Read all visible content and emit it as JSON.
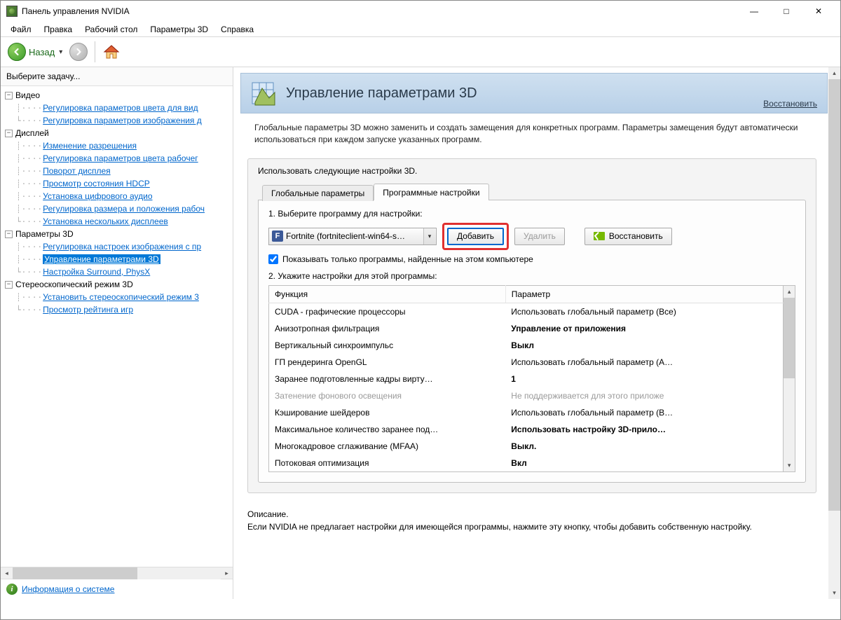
{
  "window": {
    "title": "Панель управления NVIDIA"
  },
  "menu": {
    "file": "Файл",
    "edit": "Правка",
    "desktop": "Рабочий стол",
    "params3d": "Параметры 3D",
    "help": "Справка"
  },
  "toolbar": {
    "back": "Назад"
  },
  "left": {
    "header": "Выберите задачу...",
    "tree": {
      "video": "Видео",
      "video_color": "Регулировка параметров цвета для вид",
      "video_image": "Регулировка параметров изображения д",
      "display": "Дисплей",
      "display_res": "Изменение разрешения",
      "display_color": "Регулировка параметров цвета рабочег",
      "display_rotate": "Поворот дисплея",
      "display_hdcp": "Просмотр состояния HDCP",
      "display_audio": "Установка цифрового аудио",
      "display_sizepos": "Регулировка размера и положения рабоч",
      "display_multi": "Установка нескольких дисплеев",
      "params3d": "Параметры 3D",
      "params3d_image": "Регулировка настроек изображения с пр",
      "params3d_manage": "Управление параметрами 3D",
      "params3d_physx": "Настройка Surround, PhysX",
      "stereo": "Стереоскопический режим 3D",
      "stereo_set": "Установить стереоскопический режим 3",
      "stereo_rating": "Просмотр рейтинга игр"
    },
    "sysinfo": "Информация о системе"
  },
  "content": {
    "title": "Управление параметрами 3D",
    "restore": "Восстановить",
    "desc": "Глобальные параметры 3D можно заменить и создать замещения для конкретных программ. Параметры замещения будут автоматически использоваться при каждом запуске указанных программ.",
    "box_title": "Использовать следующие настройки 3D.",
    "tabs": {
      "global": "Глобальные параметры",
      "program": "Программные настройки"
    },
    "step1": "1. Выберите программу для настройки:",
    "program": {
      "icon": "F",
      "name": "Fortnite (fortniteclient-win64-s…"
    },
    "buttons": {
      "add": "Добавить",
      "remove": "Удалить",
      "restore": "Восстановить"
    },
    "checkbox": "Показывать только программы, найденные на этом компьютере",
    "step2": "2. Укажите настройки для этой программы:",
    "table": {
      "col1": "Функция",
      "col2": "Параметр",
      "rows": [
        {
          "f": "CUDA - графические процессоры",
          "p": "Использовать глобальный параметр (Все)",
          "bold": false,
          "disabled": false
        },
        {
          "f": "Анизотропная фильтрация",
          "p": "Управление от приложения",
          "bold": true,
          "disabled": false
        },
        {
          "f": "Вертикальный синхроимпульс",
          "p": "Выкл",
          "bold": true,
          "disabled": false
        },
        {
          "f": "ГП рендеринга OpenGL",
          "p": "Использовать глобальный параметр (А…",
          "bold": false,
          "disabled": false
        },
        {
          "f": "Заранее подготовленные кадры вирту…",
          "p": "1",
          "bold": true,
          "disabled": false
        },
        {
          "f": "Затенение фонового освещения",
          "p": "Не поддерживается для этого приложе",
          "bold": false,
          "disabled": true
        },
        {
          "f": "Кэширование шейдеров",
          "p": "Использовать глобальный параметр (В…",
          "bold": false,
          "disabled": false
        },
        {
          "f": "Максимальное количество заранее под…",
          "p": "Использовать настройку 3D-прило…",
          "bold": true,
          "disabled": false
        },
        {
          "f": "Многокадровое сглаживание (MFAA)",
          "p": "Выкл.",
          "bold": true,
          "disabled": false
        },
        {
          "f": "Потоковая оптимизация",
          "p": "Вкл",
          "bold": true,
          "disabled": false
        }
      ]
    },
    "description": {
      "title": "Описание.",
      "body": "Если NVIDIA не предлагает настройки для имеющейся программы, нажмите эту кнопку, чтобы добавить собственную настройку."
    }
  }
}
